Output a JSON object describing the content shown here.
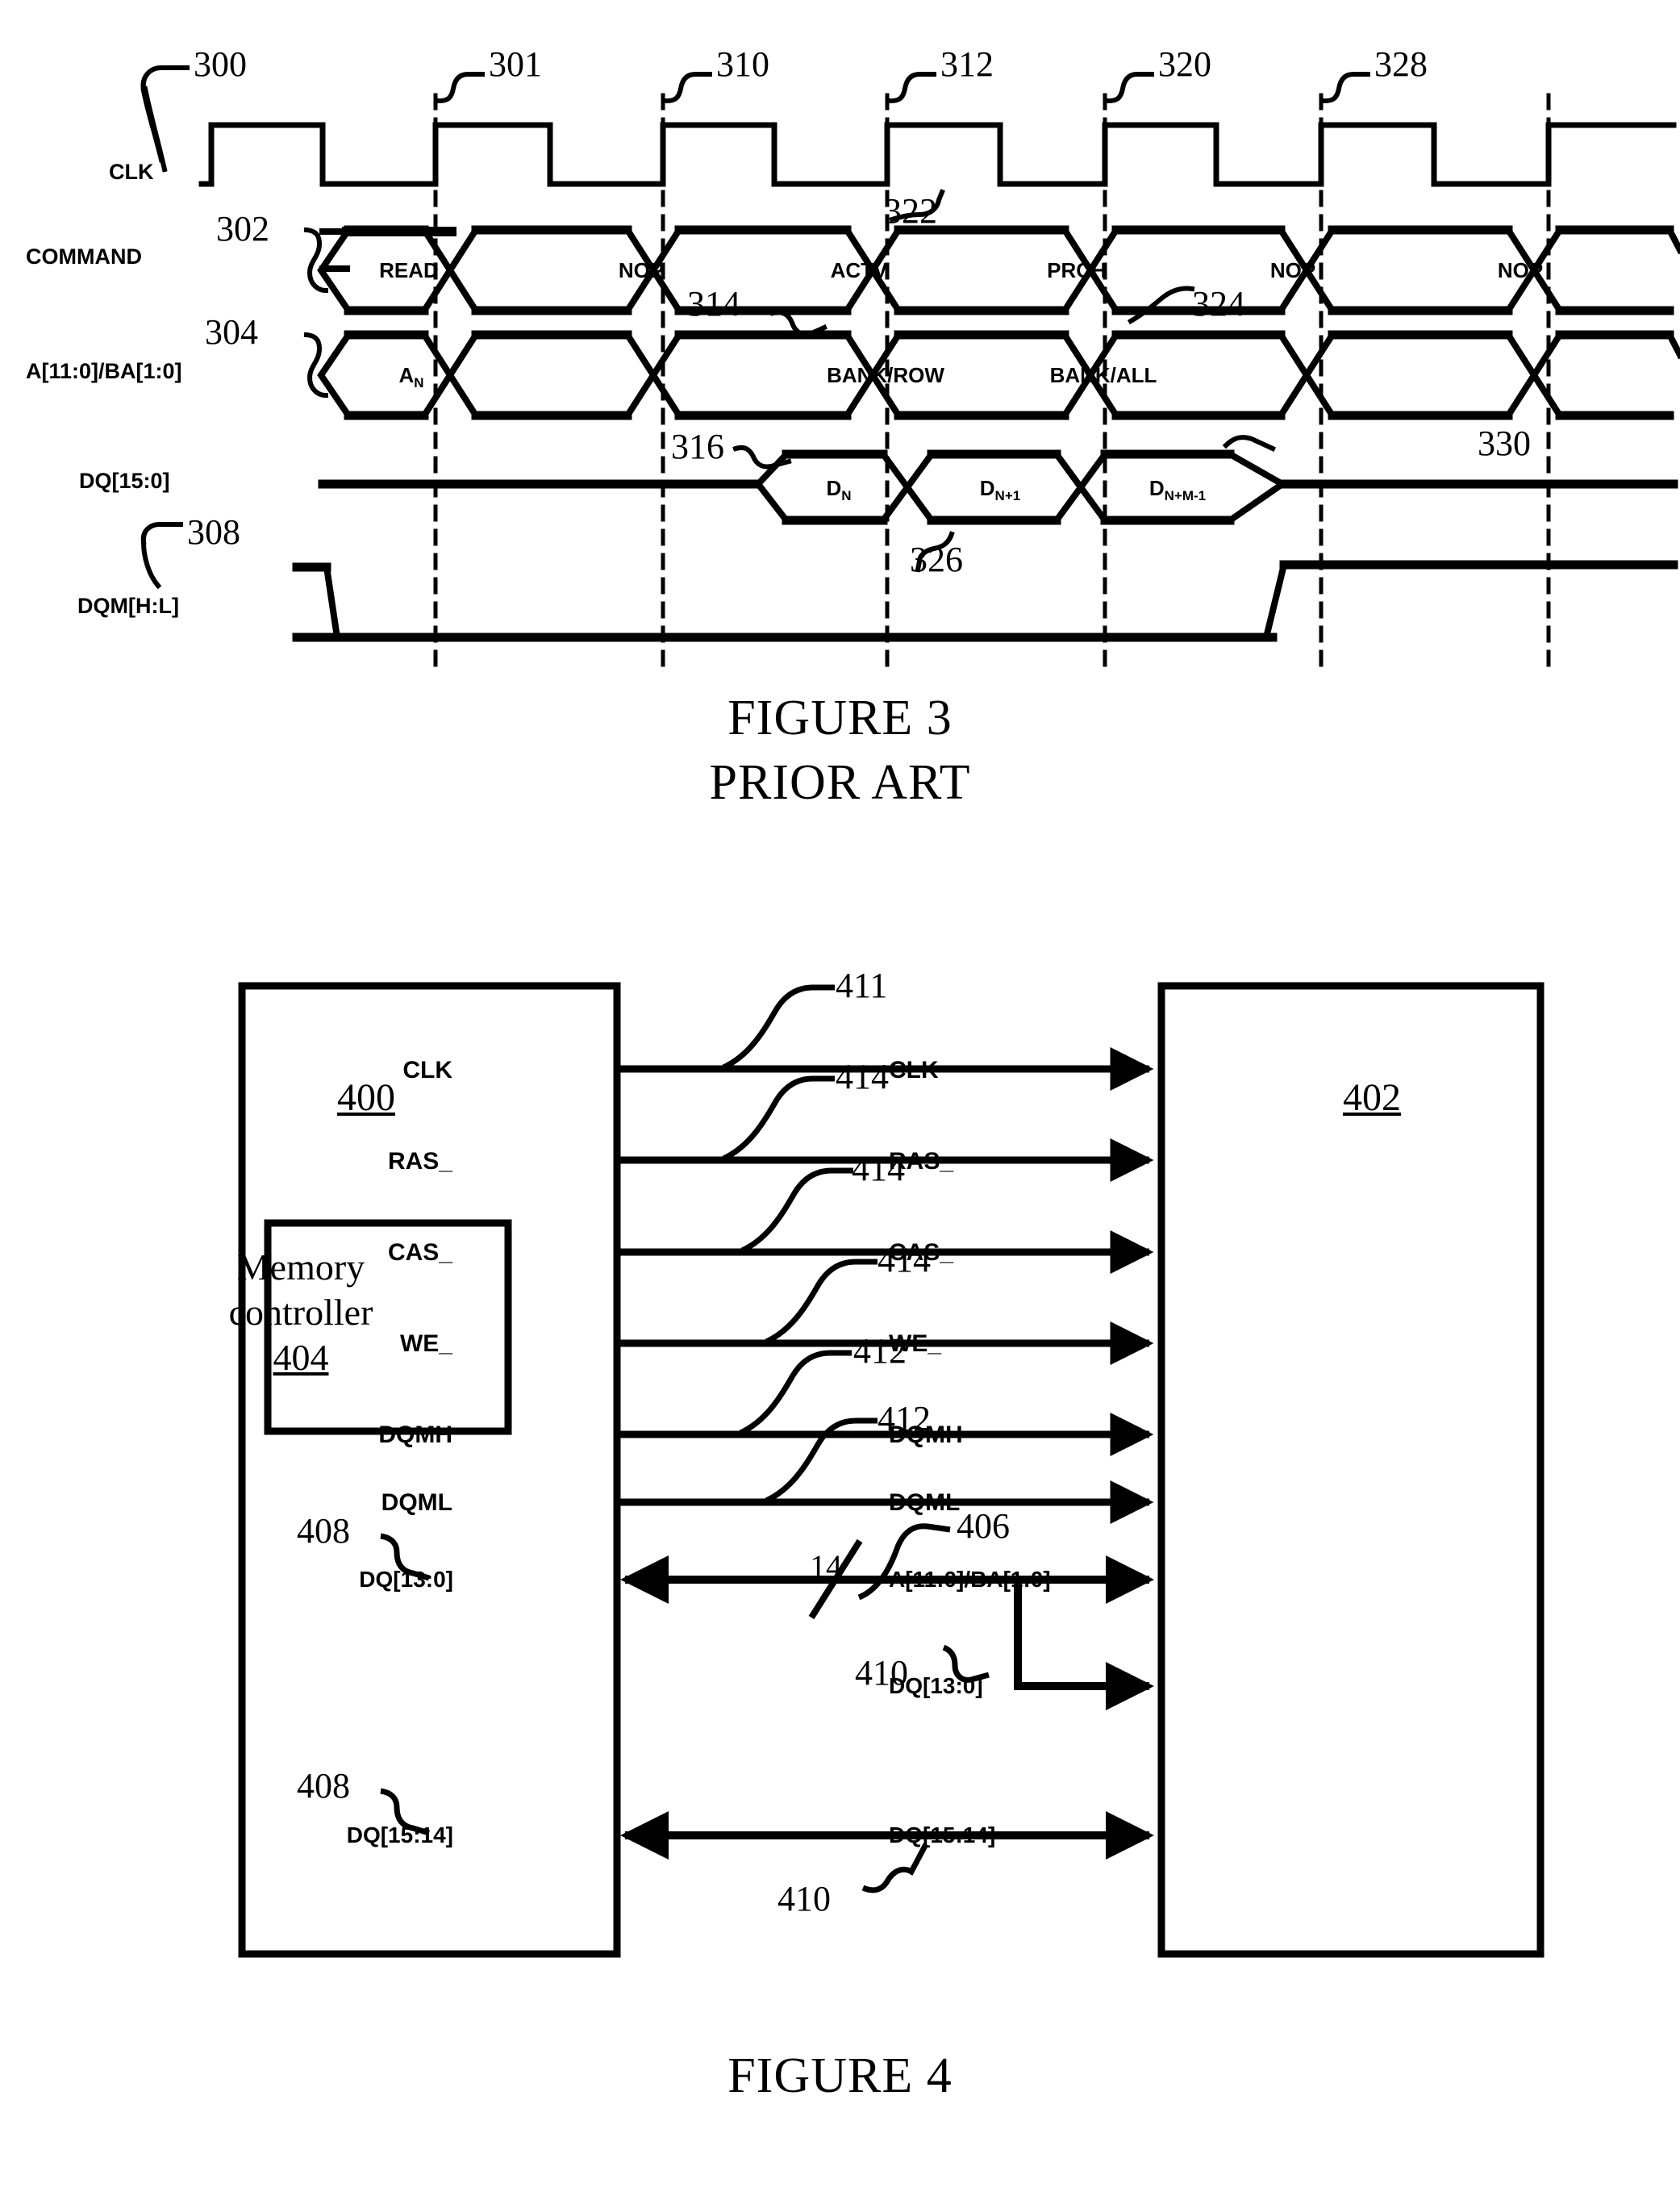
{
  "document": {
    "type": "patent-drawing-sheet",
    "figures": [
      "FIGURE 3",
      "FIGURE 4"
    ]
  },
  "figure3": {
    "caption": "FIGURE 3",
    "subcaption": "PRIOR ART",
    "row_labels": {
      "clk": "CLK",
      "command": "COMMAND",
      "address": "A[11:0]/BA[1:0]",
      "dq": "DQ[15:0]",
      "dqm": "DQM[H:L]"
    },
    "callouts": {
      "clk_waveform": "300",
      "clk_edge_1": "301",
      "clk_edge_2": "310",
      "clk_edge_3": "312",
      "clk_edge_4": "320",
      "clk_edge_5": "328",
      "command_row": "302",
      "address_row": "304",
      "dqm_row": "308",
      "actv_cmd": "322",
      "bank_row": "314",
      "dq_start": "316",
      "bank_all": "324",
      "dq_end": "326",
      "dq_last": "330"
    },
    "command_cells": [
      "READ",
      "NOP",
      "ACTV",
      "PRCH",
      "NOP",
      "NOP"
    ],
    "address_cells": [
      {
        "text": "A",
        "sub": "N"
      },
      {
        "text": "",
        "sub": ""
      },
      {
        "text": "BANK/ROW",
        "sub": ""
      },
      {
        "text": "BANK/ALL",
        "sub": ""
      },
      {
        "text": "",
        "sub": ""
      },
      {
        "text": "",
        "sub": ""
      }
    ],
    "dq_cells": [
      {
        "text": "D",
        "sub": "N"
      },
      {
        "text": "D",
        "sub": "N+1"
      },
      {
        "text": "D",
        "sub": "N+M-1"
      }
    ]
  },
  "figure4": {
    "caption": "FIGURE 4",
    "left_block": {
      "ref": "400",
      "inner_block": {
        "line1": "Memory",
        "line2": "controller",
        "ref": "404"
      },
      "pins": [
        "CLK",
        "RAS_",
        "CAS_",
        "WE_",
        "DQMH",
        "DQML",
        "DQ[13:0]",
        "DQ[15:14]"
      ]
    },
    "right_block": {
      "ref": "402",
      "pins": [
        "CLK",
        "RAS_",
        "CAS_",
        "WE_",
        "DQMH",
        "DQML",
        "A[11:0]/BA[1:0]",
        "DQ[13:0]",
        "DQ[15:14]"
      ]
    },
    "signal_callouts": {
      "clk": "411",
      "ras": "414",
      "cas": "414",
      "we": "414",
      "dqmh": "412",
      "dqml": "412",
      "address_bus": "406",
      "dq_bus_upper": "410",
      "dq_bus_lower": "410",
      "controller_dq_upper": "408",
      "controller_dq_lower": "408"
    },
    "bus_width": "14"
  },
  "colors": {
    "ink": "#000000",
    "paper": "#ffffff"
  }
}
